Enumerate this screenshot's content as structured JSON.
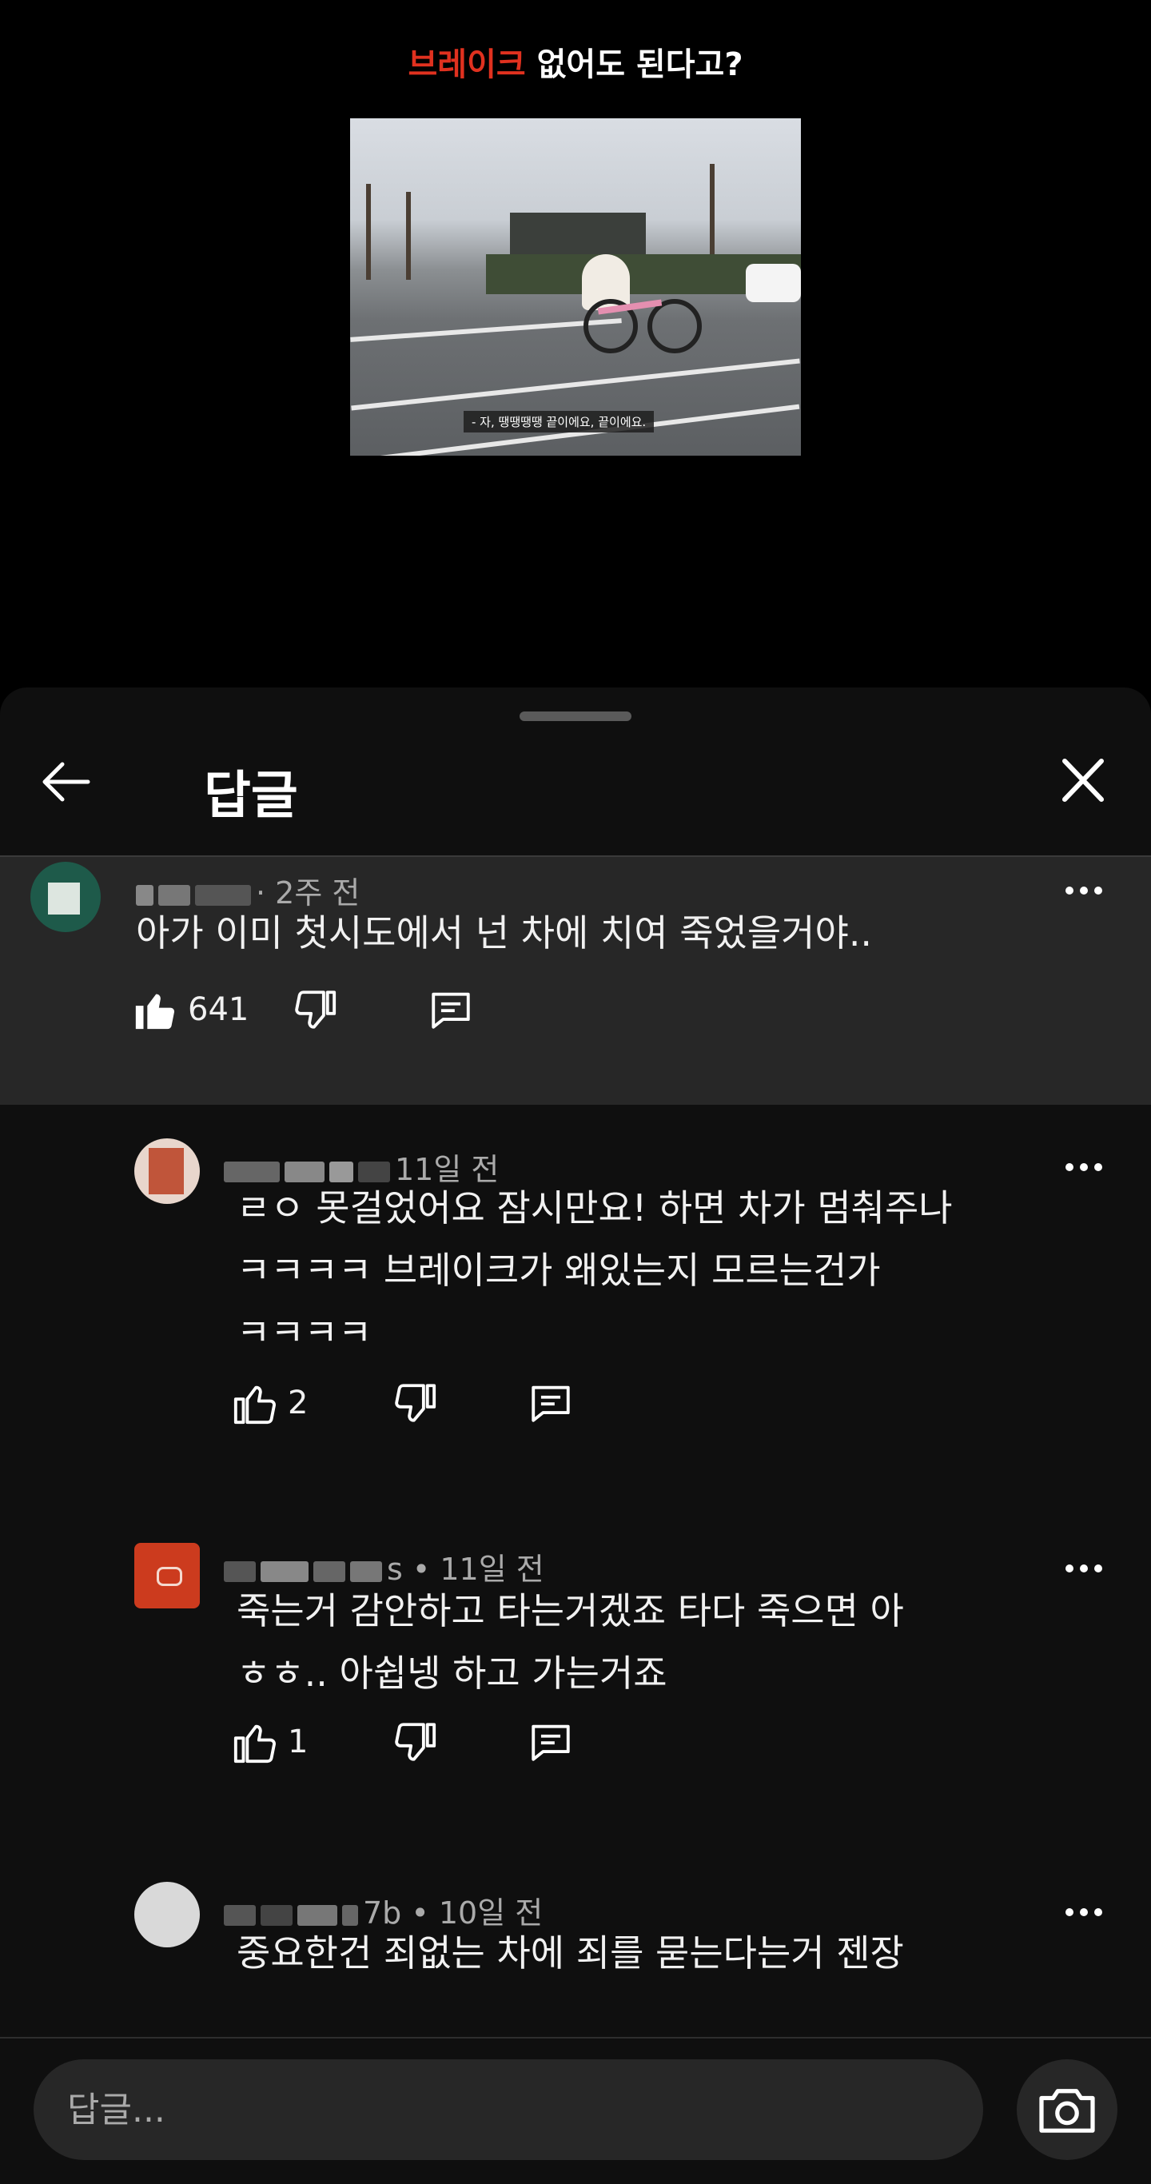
{
  "video": {
    "title_highlight": "브레이크",
    "title_rest": " 없어도 된다고?",
    "subtitle": "- 자, 땡땡땡땡 끝이에요, 끝이에요.",
    "accent_color": "#e0311f"
  },
  "sheet": {
    "title": "답글",
    "back_icon": "arrow-left-icon",
    "close_icon": "close-icon"
  },
  "comments": [
    {
      "author_tail": "·",
      "time": " 2주 전",
      "text": "아가 이미 첫시도에서 넌 차에 치여 죽었을거야..",
      "likes": "641",
      "liked": true
    },
    {
      "author_tail": "",
      "time": "11일 전",
      "text": "ㄹㅇ 못걸었어요 잠시만요! 하면 차가 멈춰주나\nㅋㅋㅋㅋ 브레이크가 왜있는지 모르는건가\nㅋㅋㅋㅋ",
      "likes": "2",
      "liked": false
    },
    {
      "author_tail": "s",
      "time": " • 11일 전",
      "text": "죽는거 감안하고 타는거겠죠 타다 죽으면 아\nㅎㅎ.. 아쉽넹 하고 가는거죠",
      "likes": "1",
      "liked": false
    },
    {
      "author_tail": "7b",
      "time": " • 10일 전",
      "text": "중요한건 죄없는 차에 죄를 묻는다는거 젠장",
      "likes": "",
      "liked": false
    }
  ],
  "footer": {
    "placeholder": "답글...",
    "camera_icon": "camera-icon"
  }
}
